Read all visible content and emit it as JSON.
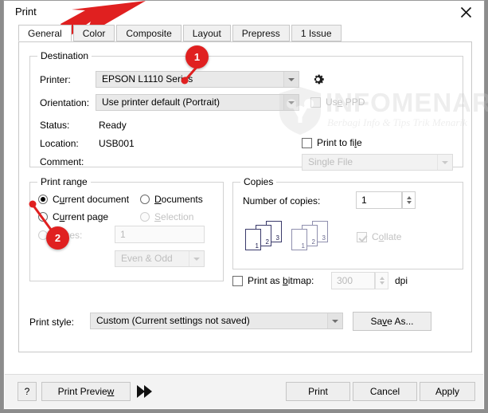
{
  "window": {
    "title": "Print",
    "close_icon": "close-icon"
  },
  "tabs": [
    {
      "label": "General",
      "active": true
    },
    {
      "label": "Color",
      "active": false
    },
    {
      "label": "Composite",
      "active": false
    },
    {
      "label": "Layout",
      "active": false
    },
    {
      "label": "Prepress",
      "active": false
    },
    {
      "label": "1 Issue",
      "active": false
    }
  ],
  "destination": {
    "group_title": "Destination",
    "printer_label": "Printer:",
    "printer_value": "EPSON L1110 Series",
    "settings_icon": "gear-icon",
    "orientation_label": "Orientation:",
    "orientation_value": "Use printer default (Portrait)",
    "use_ppd_label": "Use PPD",
    "use_ppd_checked": false,
    "use_ppd_enabled": false,
    "status_label": "Status:",
    "status_value": "Ready",
    "location_label": "Location:",
    "location_value": "USB001",
    "comment_label": "Comment:",
    "comment_value": "",
    "print_to_file_label": "Print to file",
    "print_to_file_checked": false,
    "file_mode_value": "Single File",
    "file_mode_enabled": false
  },
  "print_range": {
    "group_title": "Print range",
    "options": [
      {
        "label": "Current document",
        "selected": true,
        "enabled": true
      },
      {
        "label": "Current page",
        "selected": false,
        "enabled": true
      },
      {
        "label": "Pages:",
        "selected": false,
        "enabled": false
      },
      {
        "label": "Documents",
        "selected": false,
        "enabled": true
      },
      {
        "label": "Selection",
        "selected": false,
        "enabled": false
      }
    ],
    "pages_value": "1",
    "pages_enabled": false,
    "even_odd_value": "Even & Odd",
    "even_odd_enabled": false
  },
  "copies": {
    "group_title": "Copies",
    "number_label": "Number of copies:",
    "number_value": "1",
    "collate_label": "Collate",
    "collate_checked": true,
    "collate_enabled": false,
    "page_numbers": [
      "1",
      "2",
      "3"
    ]
  },
  "bitmap": {
    "label": "Print as bitmap:",
    "checked": false,
    "dpi_value": "300",
    "dpi_unit": "dpi",
    "dpi_enabled": false
  },
  "print_style": {
    "label": "Print style:",
    "value": "Custom (Current settings not saved)",
    "save_as_label": "Save As..."
  },
  "footer": {
    "help_label": "?",
    "preview_label": "Print Preview",
    "expand_icon": "double-chevron-right-icon",
    "print_label": "Print",
    "cancel_label": "Cancel",
    "apply_label": "Apply"
  },
  "annotations": {
    "badge_1": "1",
    "badge_2": "2",
    "arrow_icon": "red-arrow-icon",
    "arrow_color": "#e02020",
    "badge_color": "#e02020"
  },
  "watermark": {
    "brand": "INFOMENARIK",
    "tagline": "Berbagi Info & Tips Trik Menarik",
    "logo_icon": "shield-logo-icon"
  }
}
